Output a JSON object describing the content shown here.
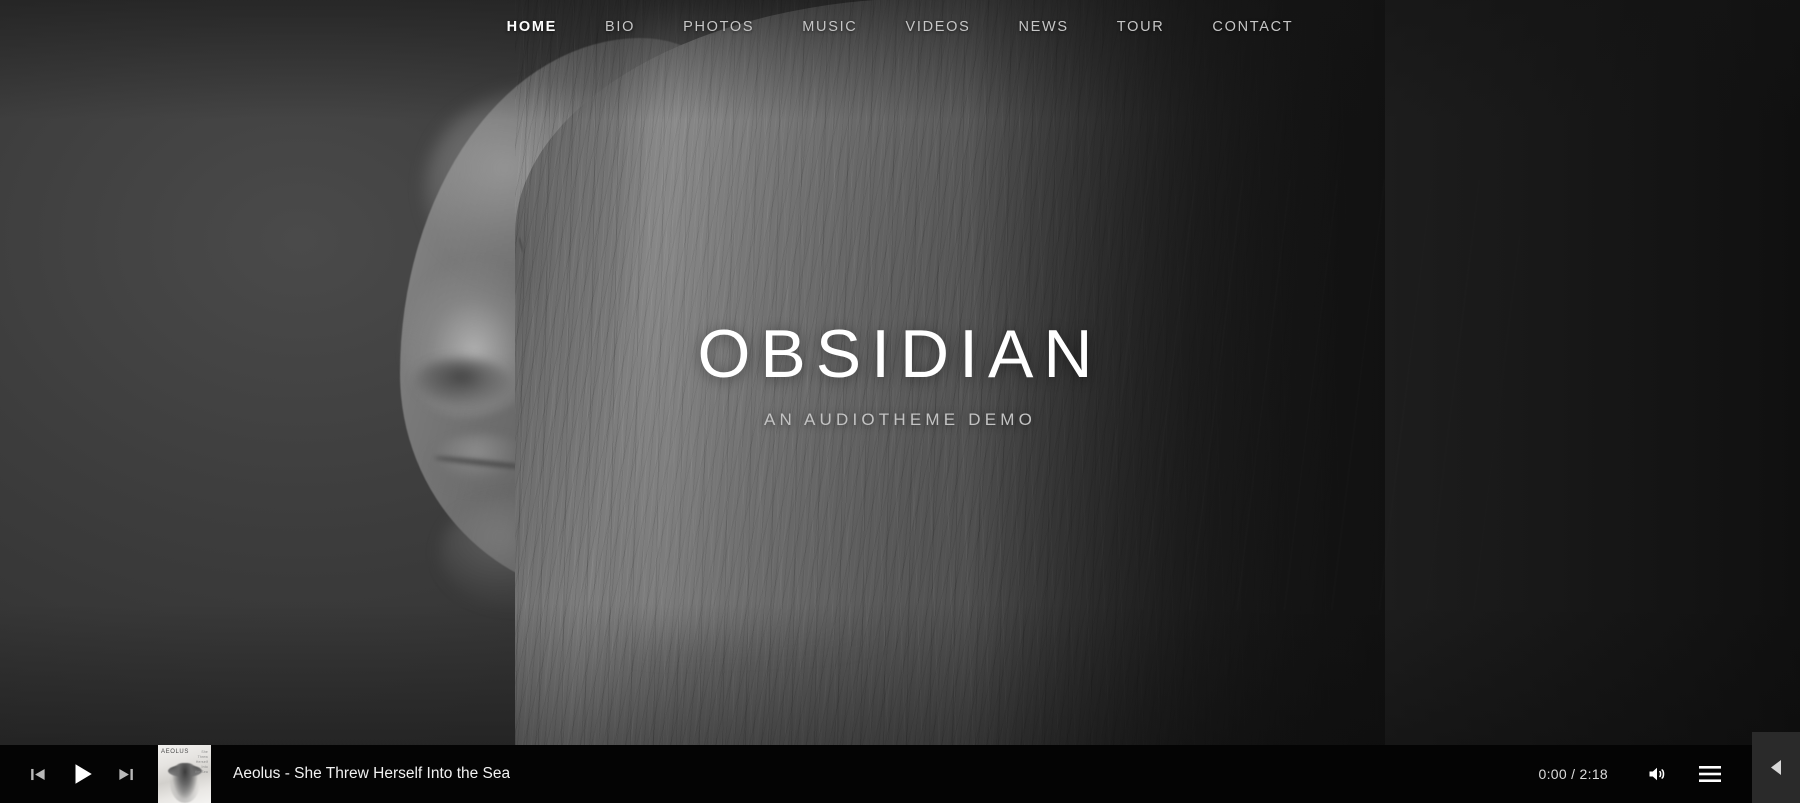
{
  "nav": {
    "items": [
      {
        "label": "HOME",
        "active": true,
        "name": "nav-item-home"
      },
      {
        "label": "BIO",
        "active": false,
        "name": "nav-item-bio"
      },
      {
        "label": "PHOTOS",
        "active": false,
        "name": "nav-item-photos"
      },
      {
        "label": "MUSIC",
        "active": false,
        "name": "nav-item-music"
      },
      {
        "label": "VIDEOS",
        "active": false,
        "name": "nav-item-videos"
      },
      {
        "label": "NEWS",
        "active": false,
        "name": "nav-item-news"
      },
      {
        "label": "TOUR",
        "active": false,
        "name": "nav-item-tour"
      },
      {
        "label": "CONTACT",
        "active": false,
        "name": "nav-item-contact"
      }
    ]
  },
  "hero": {
    "title": "OBSIDIAN",
    "subtitle": "AN AUDIOTHEME DEMO",
    "image_description": "Black and white portrait of a woman in profile with long straight hair"
  },
  "player": {
    "track": "Aeolus - She Threw Herself Into the Sea",
    "artist": "Aeolus",
    "song": "She Threw Herself Into the Sea",
    "current_time": "0:00",
    "duration": "2:18",
    "time_display": "0:00 / 2:18",
    "album_art_title": "AEOLUS",
    "album_art_subtitle": "She Threw\nHerself Into\nthe Sea",
    "state": "paused",
    "controls": {
      "previous": "previous-track",
      "play": "play",
      "next": "next-track",
      "volume": "volume",
      "playlist": "playlist-menu",
      "collapse": "collapse-player"
    }
  },
  "colors": {
    "player_background": "#040404",
    "page_background": "#333333",
    "nav_text": "#c6c6c6",
    "nav_active_text": "#ffffff",
    "hero_title": "#ffffff",
    "hero_subtitle": "#c3c3c3",
    "collapse_tab": "#2a2a2a"
  }
}
